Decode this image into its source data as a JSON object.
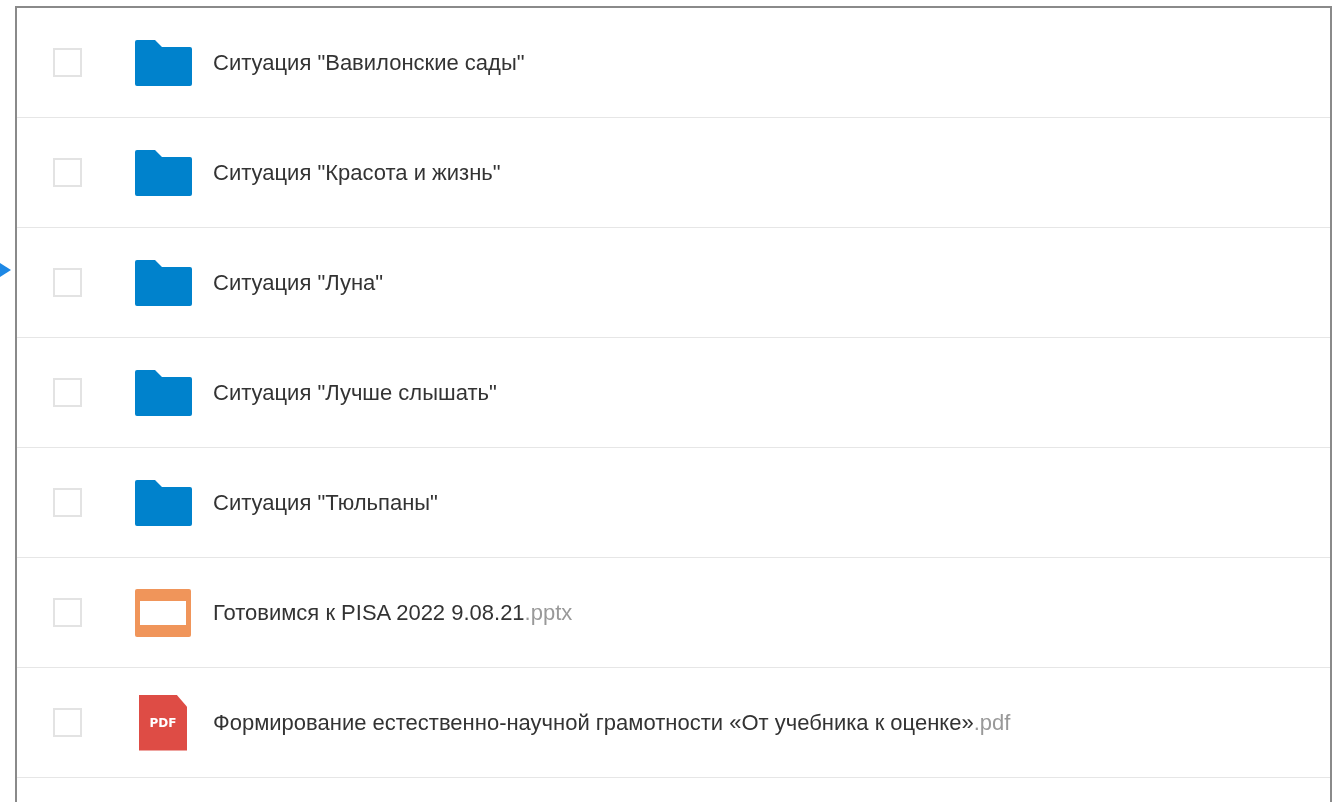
{
  "files": [
    {
      "kind": "folder",
      "name": "Ситуация \"Вавилонские сады\"",
      "checked": false
    },
    {
      "kind": "folder",
      "name": "Ситуация \"Красота и жизнь\"",
      "checked": false
    },
    {
      "kind": "folder",
      "name": "Ситуация \"Луна\"",
      "checked": false
    },
    {
      "kind": "folder",
      "name": "Ситуация \"Лучше слышать\"",
      "checked": false
    },
    {
      "kind": "folder",
      "name": "Ситуация \"Тюльпаны\"",
      "checked": false
    },
    {
      "kind": "pptx",
      "name": "Готовимся к PISA 2022 9.08.21",
      "extension": ".pptx",
      "checked": false
    },
    {
      "kind": "pdf",
      "name": "Формирование естественно-научной грамотности «От учебника к оценке»",
      "extension": ".pdf",
      "badge": "PDF",
      "checked": false
    }
  ]
}
